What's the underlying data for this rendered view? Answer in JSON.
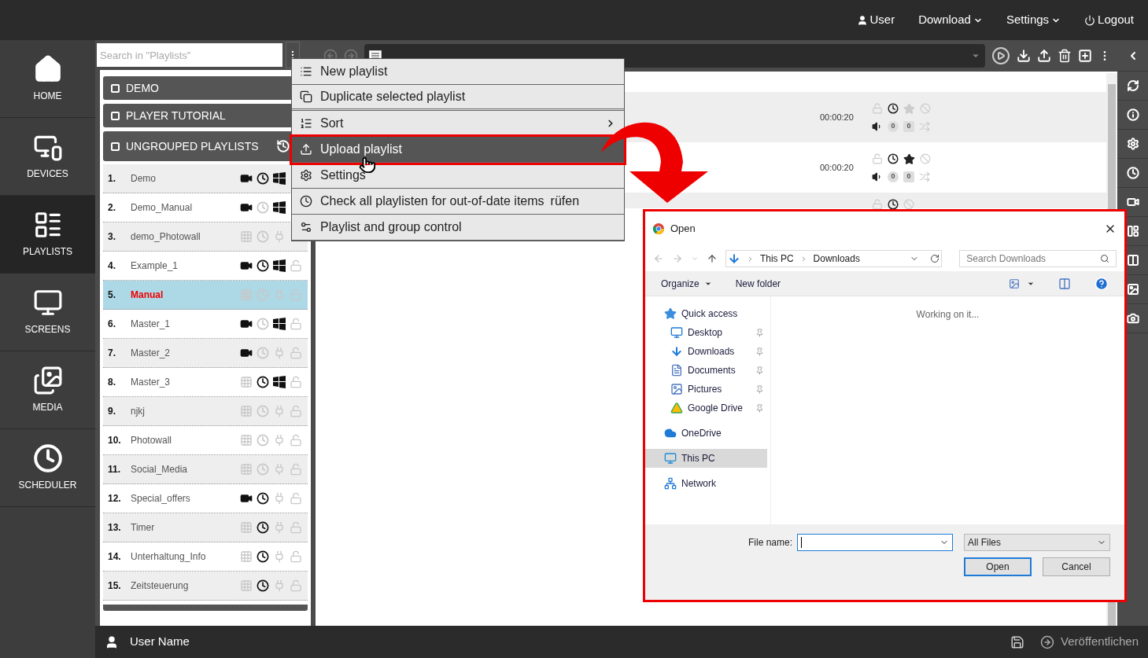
{
  "top_menu": [
    {
      "kind": "user",
      "label": "User",
      "dropdown": false
    },
    {
      "kind": "plain",
      "label": "Download",
      "dropdown": true
    },
    {
      "kind": "plain",
      "label": "Settings",
      "dropdown": true
    },
    {
      "kind": "logout",
      "label": "Logout",
      "dropdown": false
    }
  ],
  "nav": [
    {
      "kind": "home",
      "label": "HOME",
      "selected": false
    },
    {
      "kind": "devices",
      "label": "DEVICES",
      "selected": false
    },
    {
      "kind": "playlists",
      "label": "PLAYLISTS",
      "selected": true
    },
    {
      "kind": "screens",
      "label": "SCREENS",
      "selected": false
    },
    {
      "kind": "media",
      "label": "MEDIA",
      "selected": false
    },
    {
      "kind": "scheduler",
      "label": "SCHEDULER",
      "selected": false
    }
  ],
  "search": {
    "placeholder": "Search in \"Playlists\""
  },
  "groups": [
    {
      "label": "DEMO",
      "checked": false,
      "history": false
    },
    {
      "label": "PLAYER TUTORIAL",
      "checked": false,
      "history": false
    },
    {
      "label": "UNGROUPED PLAYLISTS",
      "checked": false,
      "history": true
    }
  ],
  "playlists": [
    {
      "number": "1.",
      "name": "Demo",
      "selected": false,
      "icons": [
        {
          "kind": "video",
          "active": true
        },
        {
          "kind": "clock",
          "active": true
        },
        {
          "kind": "windows",
          "active": true
        }
      ]
    },
    {
      "number": "2.",
      "name": "Demo_Manual",
      "selected": false,
      "icons": [
        {
          "kind": "video",
          "active": true
        },
        {
          "kind": "clock",
          "active": false
        },
        {
          "kind": "windows",
          "active": true
        }
      ]
    },
    {
      "number": "3.",
      "name": "demo_Photowall",
      "selected": false,
      "icons": [
        {
          "kind": "grid",
          "active": false
        },
        {
          "kind": "clock",
          "active": false
        },
        {
          "kind": "plug",
          "active": false
        }
      ]
    },
    {
      "number": "4.",
      "name": "Example_1",
      "selected": false,
      "icons": [
        {
          "kind": "video",
          "active": true
        },
        {
          "kind": "clock",
          "active": true
        },
        {
          "kind": "windows",
          "active": true
        },
        {
          "kind": "lock",
          "active": false
        }
      ]
    },
    {
      "number": "5.",
      "name": "Manual",
      "selected": true,
      "icons": [
        {
          "kind": "grid",
          "active": false
        },
        {
          "kind": "clock",
          "active": false
        },
        {
          "kind": "plug",
          "active": false
        },
        {
          "kind": "lock",
          "active": false
        }
      ]
    },
    {
      "number": "6.",
      "name": "Master_1",
      "selected": false,
      "icons": [
        {
          "kind": "video",
          "active": true
        },
        {
          "kind": "clock",
          "active": false
        },
        {
          "kind": "windows",
          "active": true
        },
        {
          "kind": "lock",
          "active": false
        }
      ]
    },
    {
      "number": "7.",
      "name": "Master_2",
      "selected": false,
      "icons": [
        {
          "kind": "video",
          "active": true
        },
        {
          "kind": "clock",
          "active": false
        },
        {
          "kind": "plug",
          "active": false
        },
        {
          "kind": "lock",
          "active": false
        }
      ]
    },
    {
      "number": "8.",
      "name": "Master_3",
      "selected": false,
      "icons": [
        {
          "kind": "grid",
          "active": false
        },
        {
          "kind": "clock",
          "active": true
        },
        {
          "kind": "windows",
          "active": true
        },
        {
          "kind": "lock",
          "active": false
        }
      ]
    },
    {
      "number": "9.",
      "name": "njkj",
      "selected": false,
      "icons": [
        {
          "kind": "grid",
          "active": false
        },
        {
          "kind": "clock",
          "active": false
        },
        {
          "kind": "plug",
          "active": false
        },
        {
          "kind": "lock",
          "active": false
        }
      ]
    },
    {
      "number": "10.",
      "name": "Photowall",
      "selected": false,
      "icons": [
        {
          "kind": "grid",
          "active": false
        },
        {
          "kind": "clock",
          "active": false
        },
        {
          "kind": "plug",
          "active": false
        },
        {
          "kind": "lock",
          "active": false
        }
      ]
    },
    {
      "number": "11.",
      "name": "Social_Media",
      "selected": false,
      "icons": [
        {
          "kind": "grid",
          "active": false
        },
        {
          "kind": "clock",
          "active": false
        },
        {
          "kind": "plug",
          "active": false
        },
        {
          "kind": "lock",
          "active": false
        }
      ]
    },
    {
      "number": "12.",
      "name": "Special_offers",
      "selected": false,
      "icons": [
        {
          "kind": "video",
          "active": true
        },
        {
          "kind": "clock",
          "active": true
        },
        {
          "kind": "plug",
          "active": false
        },
        {
          "kind": "lock",
          "active": false
        }
      ]
    },
    {
      "number": "13.",
      "name": "Timer",
      "selected": false,
      "icons": [
        {
          "kind": "grid",
          "active": false
        },
        {
          "kind": "clock",
          "active": true
        },
        {
          "kind": "plug",
          "active": false
        },
        {
          "kind": "lock",
          "active": false
        }
      ]
    },
    {
      "number": "14.",
      "name": "Unterhaltung_Info",
      "selected": false,
      "icons": [
        {
          "kind": "grid",
          "active": false
        },
        {
          "kind": "clock",
          "active": true
        },
        {
          "kind": "plug",
          "active": false
        },
        {
          "kind": "lock",
          "active": false
        }
      ]
    },
    {
      "number": "15.",
      "name": "Zeitsteuerung",
      "selected": false,
      "icons": [
        {
          "kind": "grid",
          "active": false
        },
        {
          "kind": "clock",
          "active": true
        },
        {
          "kind": "plug",
          "active": false
        },
        {
          "kind": "lock",
          "active": false
        }
      ]
    }
  ],
  "menu": [
    {
      "kind": "new",
      "label": "New playlist",
      "selected": false,
      "submenu": false
    },
    {
      "kind": "duplicate",
      "label": "Duplicate selected playlist",
      "selected": false,
      "submenu": false
    },
    {
      "kind": "sort",
      "label": "Sort",
      "selected": false,
      "submenu": true
    },
    {
      "kind": "upload",
      "label": "Upload playlist",
      "selected": true,
      "submenu": false
    },
    {
      "kind": "settings",
      "label": "Settings",
      "selected": false,
      "submenu": false
    },
    {
      "kind": "check",
      "label": "Check all playlisten for out-of-date items",
      "trailing": "rüfen",
      "selected": false,
      "submenu": false
    },
    {
      "kind": "control",
      "label": "Playlist and group control",
      "selected": false,
      "submenu": false
    }
  ],
  "items": [
    {
      "kind": "full",
      "duration": "00:00:20",
      "starred": false,
      "badges": [
        "0",
        "0"
      ]
    },
    {
      "kind": "full",
      "duration": "00:00:20",
      "starred": true,
      "badges": [
        "0",
        "0"
      ]
    },
    {
      "kind": "partial"
    }
  ],
  "dialog": {
    "title": "Open",
    "path": [
      "This PC",
      "Downloads"
    ],
    "search_placeholder": "Search Downloads",
    "toolbar": [
      "Organize",
      "New folder"
    ],
    "tree": [
      {
        "kind": "quick",
        "label": "Quick access",
        "pinned": false,
        "selected": false,
        "children": [
          {
            "kind": "desktop",
            "label": "Desktop",
            "pinned": true,
            "selected": false
          },
          {
            "kind": "downloads",
            "label": "Downloads",
            "pinned": true,
            "selected": false
          },
          {
            "kind": "documents",
            "label": "Documents",
            "pinned": true,
            "selected": false
          },
          {
            "kind": "pictures",
            "label": "Pictures",
            "pinned": true,
            "selected": false
          },
          {
            "kind": "drive",
            "label": "Google Drive",
            "pinned": true,
            "selected": false
          }
        ]
      },
      {
        "kind": "onedrive",
        "label": "OneDrive",
        "pinned": false,
        "selected": false
      },
      {
        "kind": "pc",
        "label": "This PC",
        "pinned": false,
        "selected": true
      },
      {
        "kind": "network",
        "label": "Network",
        "pinned": false,
        "selected": false
      }
    ],
    "status": "Working on it...",
    "filename_label": "File name:",
    "filter": "All Files",
    "buttons": [
      "Open",
      "Cancel"
    ]
  },
  "footer": {
    "user": "User Name",
    "publish": "Veröffentlichen"
  }
}
